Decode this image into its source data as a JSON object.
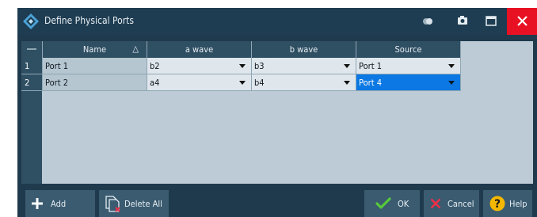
{
  "window": {
    "title": "Define Physical Ports"
  },
  "table": {
    "columns": [
      "Name",
      "a wave",
      "b wave",
      "Source"
    ],
    "sort_indicator": "△",
    "rows": [
      {
        "index": "1",
        "name": "Port 1",
        "a_wave": "b2",
        "b_wave": "b3",
        "source": "Port 1"
      },
      {
        "index": "2",
        "name": "Port 2",
        "a_wave": "a4",
        "b_wave": "b4",
        "source": "Port 4"
      }
    ],
    "selected_cell": {
      "row": 2,
      "column": "Source"
    }
  },
  "buttons": {
    "add": "Add",
    "delete_all": "Delete All",
    "ok": "OK",
    "cancel": "Cancel",
    "help": "Help"
  },
  "colors": {
    "titlebar": "#1e3d52",
    "window_bg": "#1f3a4d",
    "close_button": "#e81123",
    "selection": "#0b78e3",
    "ok_icon": "#57c93a",
    "cancel_icon": "#e8324a",
    "help_icon": "#f5b800"
  },
  "icons": {
    "app": "rohde-schwarz-logo-icon",
    "titlebar": [
      "toggle-icon",
      "camera-icon",
      "maximize-icon",
      "close-icon"
    ],
    "add": "plus-icon",
    "delete_all": "delete-pages-icon",
    "ok": "checkmark-icon",
    "cancel": "x-icon",
    "help": "question-icon"
  }
}
